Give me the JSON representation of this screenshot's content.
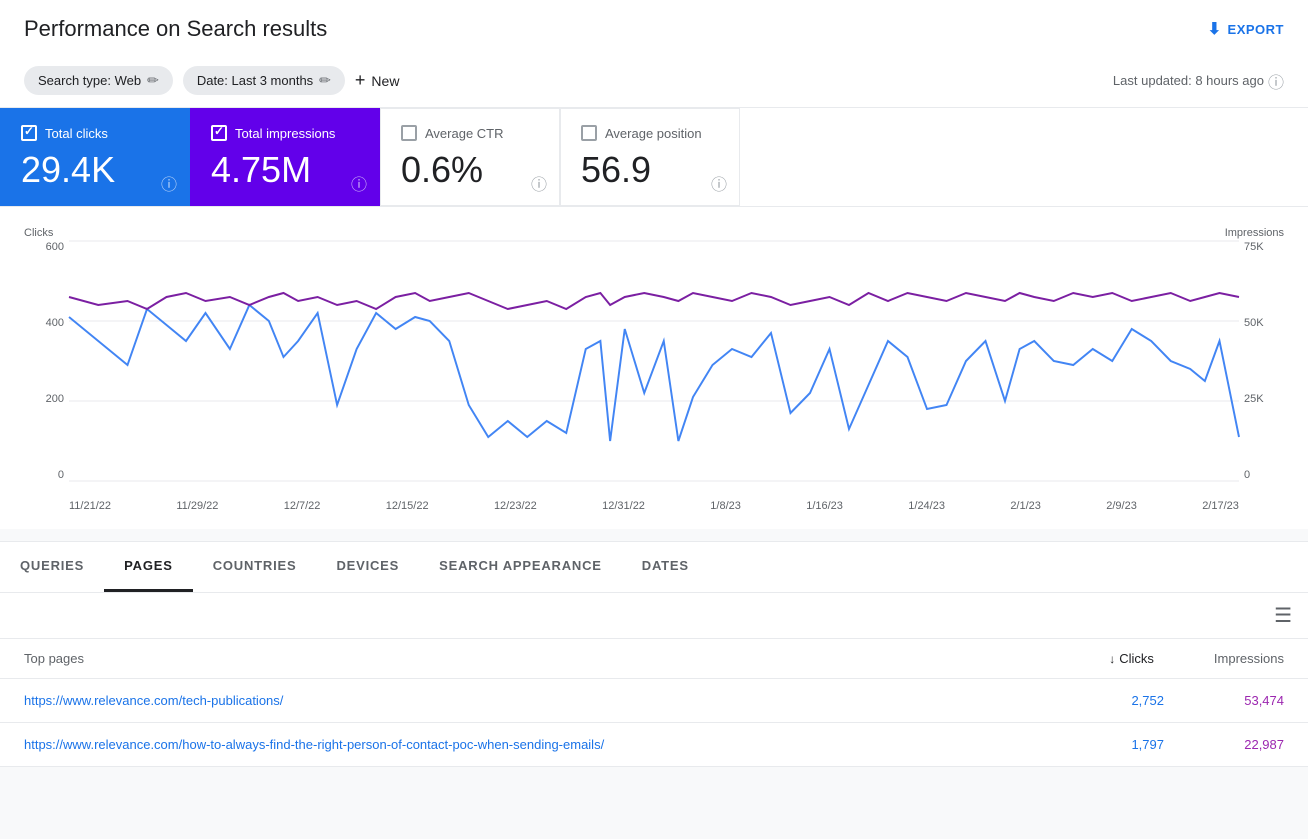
{
  "header": {
    "title": "Performance on Search results",
    "export_label": "EXPORT"
  },
  "filters": {
    "search_type_label": "Search type: Web",
    "date_label": "Date: Last 3 months",
    "new_label": "New",
    "last_updated": "Last updated: 8 hours ago"
  },
  "metrics": [
    {
      "id": "total-clicks",
      "label": "Total clicks",
      "value": "29.4K",
      "active": true,
      "color": "blue",
      "checked": true
    },
    {
      "id": "total-impressions",
      "label": "Total impressions",
      "value": "4.75M",
      "active": true,
      "color": "purple",
      "checked": true
    },
    {
      "id": "average-ctr",
      "label": "Average CTR",
      "value": "0.6%",
      "active": false,
      "color": "none",
      "checked": false
    },
    {
      "id": "average-position",
      "label": "Average position",
      "value": "56.9",
      "active": false,
      "color": "none",
      "checked": false
    }
  ],
  "chart": {
    "left_axis_label": "Clicks",
    "right_axis_label": "Impressions",
    "y_left": [
      "600",
      "400",
      "200",
      "0"
    ],
    "y_right": [
      "75K",
      "50K",
      "25K",
      "0"
    ],
    "x_labels": [
      "11/21/22",
      "11/29/22",
      "12/7/22",
      "12/15/22",
      "12/23/22",
      "12/31/22",
      "1/8/23",
      "1/16/23",
      "1/24/23",
      "2/1/23",
      "2/9/23",
      "2/17/23"
    ]
  },
  "tabs": [
    {
      "id": "queries",
      "label": "QUERIES",
      "active": false
    },
    {
      "id": "pages",
      "label": "PAGES",
      "active": true
    },
    {
      "id": "countries",
      "label": "COUNTRIES",
      "active": false
    },
    {
      "id": "devices",
      "label": "DEVICES",
      "active": false
    },
    {
      "id": "search-appearance",
      "label": "SEARCH APPEARANCE",
      "active": false
    },
    {
      "id": "dates",
      "label": "DATES",
      "active": false
    }
  ],
  "table": {
    "top_pages_label": "Top pages",
    "col_clicks": "Clicks",
    "col_impressions": "Impressions",
    "rows": [
      {
        "url": "https://www.relevance.com/tech-publications/",
        "clicks": "2,752",
        "impressions": "53,474"
      },
      {
        "url": "https://www.relevance.com/how-to-always-find-the-right-person-of-contact-poc-when-sending-emails/",
        "clicks": "1,797",
        "impressions": "22,987"
      }
    ]
  }
}
